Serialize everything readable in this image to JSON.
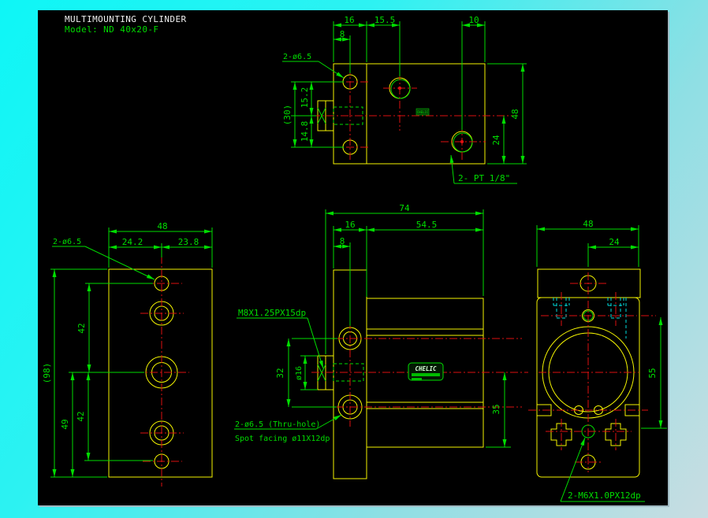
{
  "title": {
    "name": "MULTIMOUNTING CYLINDER",
    "model": "Model: ND 40x20-F"
  },
  "brand": {
    "logo": "CHELIC"
  },
  "views": {
    "top_view": {
      "d16": "16",
      "d15_5": "15.5",
      "d10": "10",
      "d8": "8",
      "hole_label": "2-ø6.5",
      "d30": "(30)",
      "d15_2": "15.2",
      "d14_8": "14.8",
      "d48": "48",
      "d24": "24",
      "port_label": "2- PT 1/8\""
    },
    "side_view": {
      "d48": "48",
      "d24_2": "24.2",
      "d23_8": "23.8",
      "hole_label": "2-ø6.5",
      "d42_upper": "42",
      "d42_lower": "42",
      "d49": "49",
      "d98": "(98)"
    },
    "front_view": {
      "d74": "74",
      "d16": "16",
      "d54_5": "54.5",
      "d8": "8",
      "rod_thread_label": "M8X1.25PX15dp",
      "d32": "32",
      "dia16": "ø16",
      "thru_hole_label": "2-ø6.5 (Thru-hole)",
      "spot_facing_label": "Spot facing ø11X12dp",
      "d35": "35"
    },
    "end_view": {
      "d48": "48",
      "d24": "24",
      "d55": "55",
      "thread_label": "2-M6X1.0PX12dp"
    }
  },
  "colors": {
    "outline": "#f5f500",
    "dimension": "#00dd00",
    "centerline": "#dd1111",
    "hidden": "#00dddd",
    "title_text": "#f0f0f0",
    "canvas_background": "#000000",
    "frame": "#0ef6f6"
  }
}
